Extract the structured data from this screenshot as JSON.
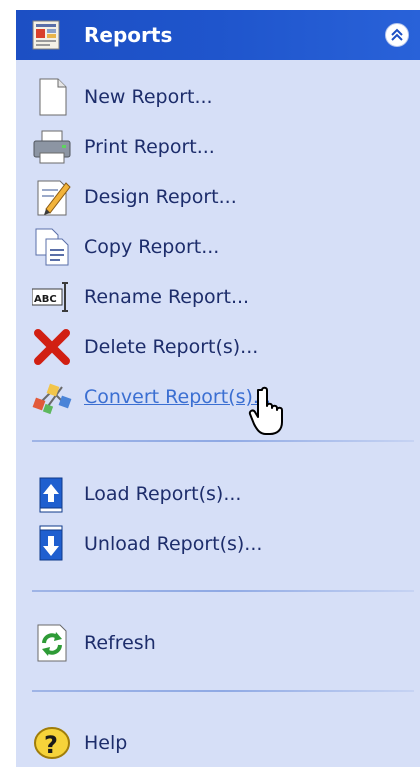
{
  "panel": {
    "title": "Reports",
    "header_icon": "reports-icon",
    "collapse_icon": "double-chevron-up-icon"
  },
  "items": [
    {
      "label": "New Report...",
      "icon": "new-document-icon"
    },
    {
      "label": "Print Report...",
      "icon": "printer-icon"
    },
    {
      "label": "Design Report...",
      "icon": "pencil-document-icon"
    },
    {
      "label": "Copy Report...",
      "icon": "copy-documents-icon"
    },
    {
      "label": "Rename Report...",
      "icon": "rename-abc-icon"
    },
    {
      "label": "Delete Report(s)...",
      "icon": "red-x-icon"
    },
    {
      "label": "Convert Report(s)...",
      "icon": "convert-shapes-icon",
      "state": "hover"
    },
    {
      "label": "Load Report(s)...",
      "icon": "upload-arrow-icon"
    },
    {
      "label": "Unload Report(s)...",
      "icon": "download-arrow-icon"
    },
    {
      "label": "Refresh",
      "icon": "refresh-icon"
    },
    {
      "label": "Help",
      "icon": "help-question-icon"
    }
  ],
  "colors": {
    "header": "#1f55cc",
    "panel_bg": "#d6dff7",
    "link_text": "#1d2d6b",
    "link_hover": "#3b6fd2"
  }
}
